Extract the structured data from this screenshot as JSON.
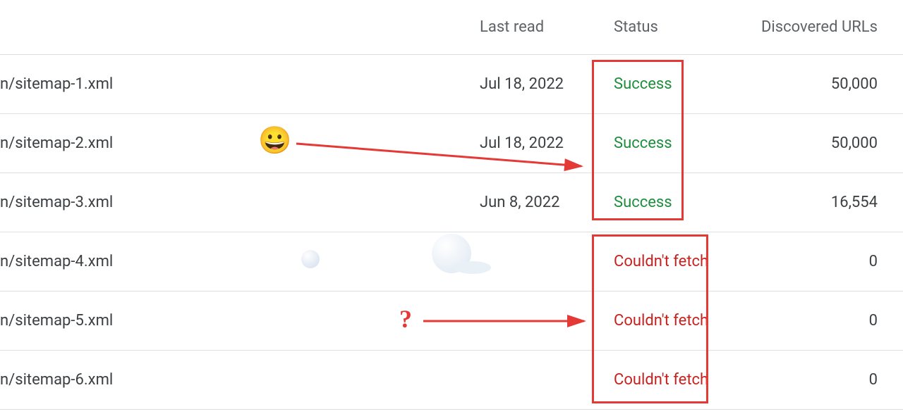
{
  "columns": {
    "sitemap": "",
    "last_read": "Last read",
    "status": "Status",
    "discovered": "Discovered URLs"
  },
  "rows": [
    {
      "sitemap": "n/sitemap-1.xml",
      "last_read": "Jul 18, 2022",
      "status": "Success",
      "status_class": "success",
      "urls": "50,000"
    },
    {
      "sitemap": "n/sitemap-2.xml",
      "last_read": "Jul 18, 2022",
      "status": "Success",
      "status_class": "success",
      "urls": "50,000"
    },
    {
      "sitemap": "n/sitemap-3.xml",
      "last_read": "Jun 8, 2022",
      "status": "Success",
      "status_class": "success",
      "urls": "16,554"
    },
    {
      "sitemap": "n/sitemap-4.xml",
      "last_read": "",
      "status": "Couldn't fetch",
      "status_class": "error",
      "urls": "0"
    },
    {
      "sitemap": "n/sitemap-5.xml",
      "last_read": "",
      "status": "Couldn't fetch",
      "status_class": "error",
      "urls": "0"
    },
    {
      "sitemap": "n/sitemap-6.xml",
      "last_read": "",
      "status": "Couldn't fetch",
      "status_class": "error",
      "urls": "0"
    }
  ],
  "annotations": {
    "emoji": "😀",
    "question": "?"
  }
}
